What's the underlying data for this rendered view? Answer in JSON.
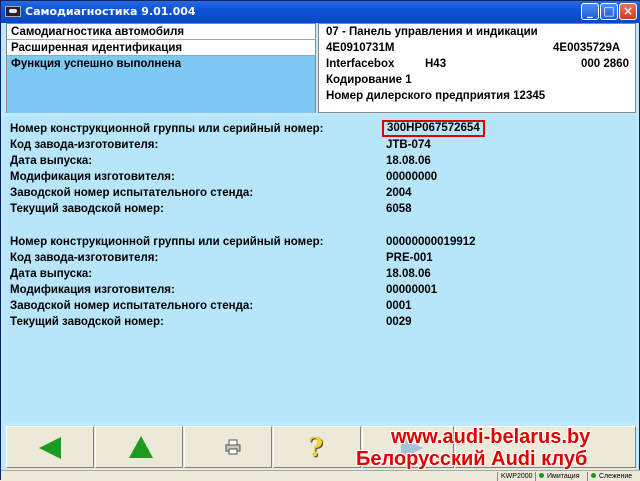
{
  "window": {
    "title": "Самодиагностика 9.01.004",
    "min_label": "_",
    "max_label": "□",
    "close_label": "×"
  },
  "left_panel": {
    "row1": "Самодиагностика автомобиля",
    "row2": "Расширенная идентификация",
    "status": "Функция успешно выполнена"
  },
  "right_panel": {
    "line1": "07 - Панель управления и индикации",
    "part_number": "4E0910731M",
    "part_number_2": "4E0035729A",
    "component": "Interfacebox",
    "component_version": "H43",
    "software": "000  2860",
    "coding": "Кодирование 1",
    "dealer": "Номер дилерского предприятия 12345"
  },
  "main": {
    "group1": [
      {
        "label": "Номер конструкционной группы или серийный номер:",
        "value": "300HP067572654"
      },
      {
        "label": "Код завода-изготовителя:",
        "value": "JTB-074"
      },
      {
        "label": "Дата выпуска:",
        "value": "18.08.06"
      },
      {
        "label": "Модификация изготовителя:",
        "value": "00000000"
      },
      {
        "label": "Заводской номер испытательного стенда:",
        "value": "2004"
      },
      {
        "label": "Текущий заводской номер:",
        "value": "6058"
      }
    ],
    "group2": [
      {
        "label": "Номер конструкционной группы или серийный номер:",
        "value": "00000000019912"
      },
      {
        "label": "Код завода-изготовителя:",
        "value": "PRE-001"
      },
      {
        "label": "Дата выпуска:",
        "value": "18.08.06"
      },
      {
        "label": "Модификация изготовителя:",
        "value": "00000001"
      },
      {
        "label": "Заводской номер испытательного стенда:",
        "value": "0001"
      },
      {
        "label": "Текущий заводской номер:",
        "value": "0029"
      }
    ]
  },
  "toolbar": {
    "icons": [
      "arrow-left-icon",
      "arrow-up-icon",
      "printer-icon",
      "help-icon",
      "arrow-right-icon"
    ]
  },
  "watermark": {
    "line1": "www.audi-belarus.by",
    "line2": "Белорусский Audi клуб"
  },
  "statusbar": {
    "protocol": "KWP2000",
    "imitation": "Имитация",
    "tracking": "Слежение"
  },
  "colors": {
    "titlebar": "#0a54d9",
    "status_highlight": "#7ec8f4",
    "content_bg": "#b7e6fb",
    "highlight_box": "#e00000",
    "arrow_green": "#1e9b1e"
  }
}
